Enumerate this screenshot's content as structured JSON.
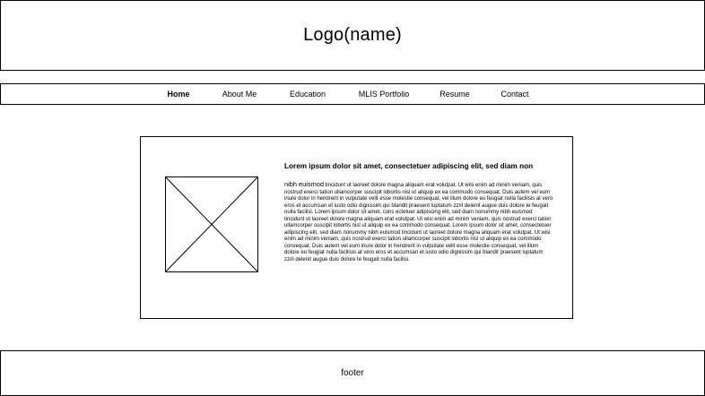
{
  "header": {
    "logo_text": "Logo(name)"
  },
  "nav": {
    "items": [
      {
        "label": "Home",
        "active": true
      },
      {
        "label": "About Me",
        "active": false
      },
      {
        "label": "Education",
        "active": false
      },
      {
        "label": "MLIS Portfolio",
        "active": false
      },
      {
        "label": "Resume",
        "active": false
      },
      {
        "label": "Contact",
        "active": false
      }
    ]
  },
  "main": {
    "image_icon": "image-placeholder-icon",
    "heading": "Lorem ipsum dolor sit amet, consectetuer adipiscing elit, sed diam non",
    "body_first_word": "nibh euismod",
    "body_text": " tincidunt ut laoreet dolore magna aliquam erat volutpat. Ut wisi enim ad minim veniam, quis nostrud exerci tation ullamcorper suscipit lobortis nisl ut aliquip ex ea commodo consequat. Duis autem vel eum iriure dolor in hendrerit in vulputate velit esse molestie consequat, vel illum dolore eu feugiat nulla facilisis at vero eros et accumsan et iusto odio dignissim qui blandit praesent luptatum zzril delenit augue duis dolore te feugait nulla facilisi. Lorem ipsum dolor sit amet, cons ectetuer adipiscing elit, sed diam nonummy nibh euismod tincidunt ut laoreet dolore magna aliquam erat volutpat. Ut wisi enim ad minim veniam, quis nostrud exerci tation ullamcorper suscipit lobortis nisl ut aliquip ex ea commodo consequat. Lorem ipsum dolor sit amet, consectetuer adipiscing elit, sed diam nonummy nibh euismod tincidunt ut laoreet dolore magna aliquam erat volutpat. Ut wisi enim ad minim veniam, quis nostrud exerci tation ullamcorper suscipit lobortis nisl ut aliquip ex ea commodo consequat. Duis autem vel eum iriure dolor in hendrerit in vulputate velit esse molestie consequat, vel illum dolore eu feugiat nulla facilisis at vero eros et accumsan et iusto odio dignissim qui blandit praesent luptatum zzril delenit augue duis dolore te feugait nulla facilisi."
  },
  "footer": {
    "text": "footer"
  }
}
